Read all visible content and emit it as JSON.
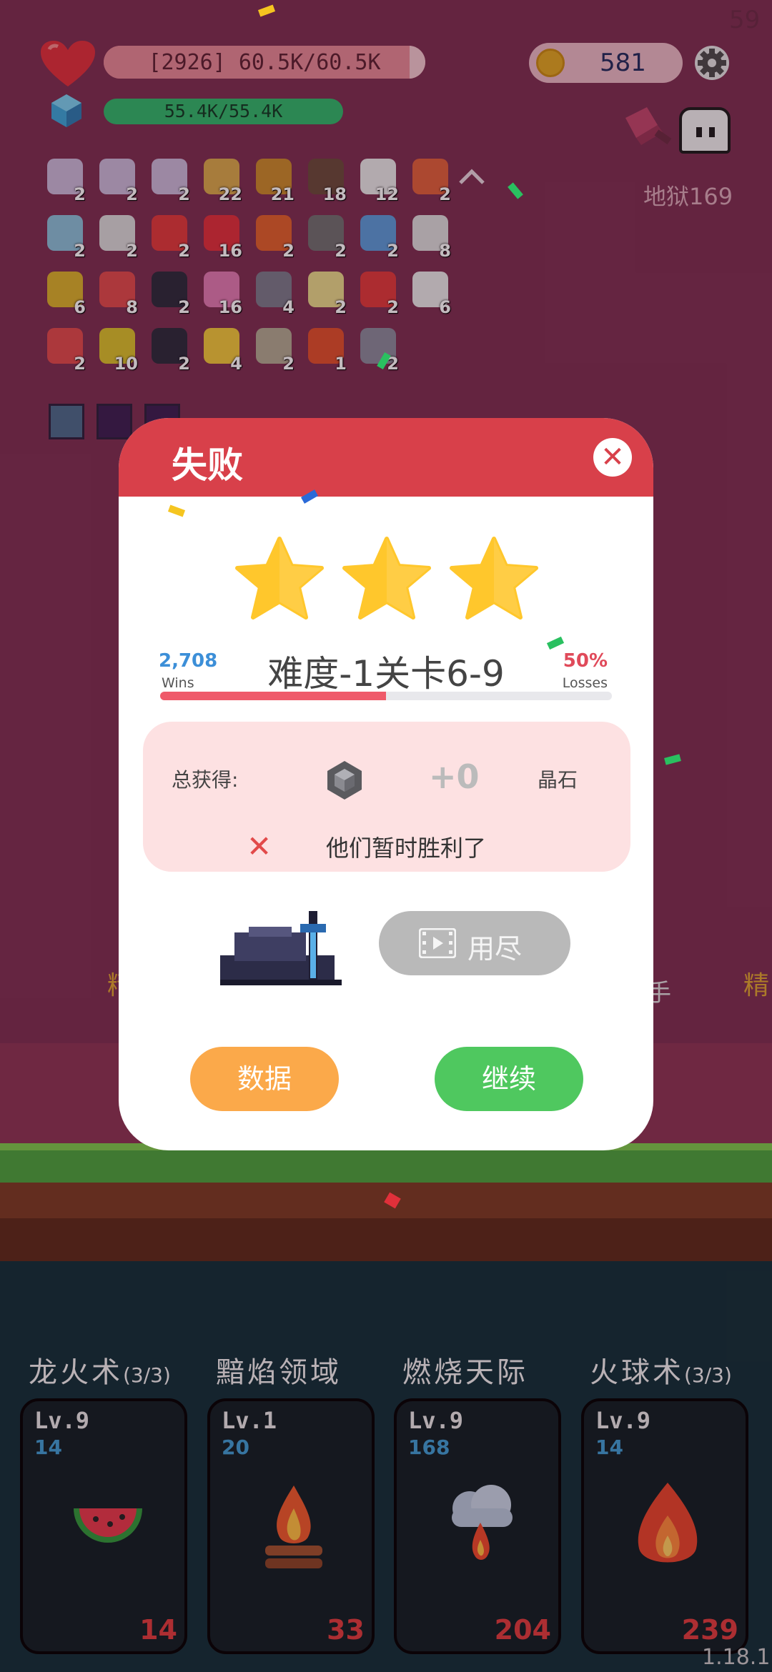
{
  "hud": {
    "fps": "59",
    "hp_text": "[2926] 60.5K/60.5K",
    "hp_fraction": 0.97,
    "mp_text": "55.4K/55.4K",
    "mp_fraction": 1.0,
    "coins": "581",
    "hell_label": "地狱169"
  },
  "inventory": {
    "rows": [
      [
        {
          "icon": "scroll-card-icon",
          "count": "2",
          "color": "#c9b9d9"
        },
        {
          "icon": "scroll-card-icon",
          "count": "2",
          "color": "#c9b9d9"
        },
        {
          "icon": "scroll-card-icon",
          "count": "2",
          "color": "#c9b9d9"
        },
        {
          "icon": "map-scroll-icon",
          "count": "22",
          "color": "#d8a84a"
        },
        {
          "icon": "book-icon",
          "count": "21",
          "color": "#c98a2a"
        },
        {
          "icon": "shield-icon",
          "count": "18",
          "color": "#6a4a3a"
        },
        {
          "icon": "flower-icon",
          "count": "12",
          "color": "#e8e8e8"
        },
        {
          "icon": "heat-wave-icon",
          "count": "2",
          "color": "#e0603a"
        }
      ],
      [
        {
          "icon": "cloth-icon",
          "count": "2",
          "color": "#8ac0d8"
        },
        {
          "icon": "sword-icon",
          "count": "2",
          "color": "#d8d8d8"
        },
        {
          "icon": "map-pin-icon",
          "count": "2",
          "color": "#e03a3a"
        },
        {
          "icon": "strawberry-icon",
          "count": "16",
          "color": "#e0303a"
        },
        {
          "icon": "fire-ring-icon",
          "count": "2",
          "color": "#e0602a"
        },
        {
          "icon": "viking-helmet-icon",
          "count": "2",
          "color": "#707070"
        },
        {
          "icon": "robe-icon",
          "count": "2",
          "color": "#5a9ad8"
        },
        {
          "icon": "envelope-icon",
          "count": "8",
          "color": "#dcdcdc"
        }
      ],
      [
        {
          "icon": "pineapple-icon",
          "count": "6",
          "color": "#d8b02a"
        },
        {
          "icon": "pill-icon",
          "count": "8",
          "color": "#e04a4a"
        },
        {
          "icon": "bomb-icon",
          "count": "2",
          "color": "#2a2a3a"
        },
        {
          "icon": "ice-cream-icon",
          "count": "16",
          "color": "#e07ab0"
        },
        {
          "icon": "tombstone-icon",
          "count": "4",
          "color": "#7a7a8a"
        },
        {
          "icon": "note-pencil-icon",
          "count": "2",
          "color": "#e8d88a"
        },
        {
          "icon": "gift-box-icon",
          "count": "2",
          "color": "#e03a3a"
        },
        {
          "icon": "playing-card-icon",
          "count": "6",
          "color": "#e8e8e8"
        }
      ],
      [
        {
          "icon": "potion-icon",
          "count": "2",
          "color": "#e04a4a"
        },
        {
          "icon": "battery-icon",
          "count": "10",
          "color": "#d8c02a"
        },
        {
          "icon": "cauldron-icon",
          "count": "2",
          "color": "#2a2a3a"
        },
        {
          "icon": "cheese-icon",
          "count": "4",
          "color": "#f0c83a"
        },
        {
          "icon": "orbs-icon",
          "count": "2",
          "color": "#b0a890"
        },
        {
          "icon": "fire-icon",
          "count": "1",
          "color": "#e0502a"
        },
        {
          "icon": "meteor-icon",
          "count": "2",
          "color": "#8a8a9a"
        }
      ]
    ]
  },
  "modal": {
    "title": "失败",
    "stars_filled": 3,
    "wins_count": "2,708",
    "wins_label": "Wins",
    "losses_percent": "50%",
    "losses_label": "Losses",
    "stage_label": "难度-1关卡6-9",
    "win_rate_fraction": 0.5,
    "reward_label": "总获得:",
    "reward_amount": "+0",
    "reward_currency": "晶石",
    "fail_message": "他们暂时胜利了",
    "video_button_label": "用尽",
    "stats_button_label": "数据",
    "continue_button_label": "继续"
  },
  "background_labels": {
    "left": "精",
    "right": "精",
    "hand": "手"
  },
  "abilities": [
    {
      "title": "龙火术",
      "title_suffix": "(3/3)",
      "level": "Lv.9",
      "value": "14",
      "cost": "14",
      "art": "watermelon-icon"
    },
    {
      "title": "黯焰领域",
      "title_suffix": "",
      "level": "Lv.1",
      "value": "20",
      "cost": "33",
      "art": "campfire-icon"
    },
    {
      "title": "燃烧天际",
      "title_suffix": "",
      "level": "Lv.9",
      "value": "168",
      "cost": "204",
      "art": "fire-cloud-icon"
    },
    {
      "title": "火球术",
      "title_suffix": "(3/3)",
      "level": "Lv.9",
      "value": "14",
      "cost": "239",
      "art": "flame-icon"
    }
  ],
  "version": "1.18.1",
  "colors": {
    "background": "#7c2f50",
    "modal_header": "#d8404a",
    "stats_button": "#fba94a",
    "continue_button": "#4fc85f",
    "progress_fill": "#ef5a6a",
    "star": "#ffc72c"
  }
}
